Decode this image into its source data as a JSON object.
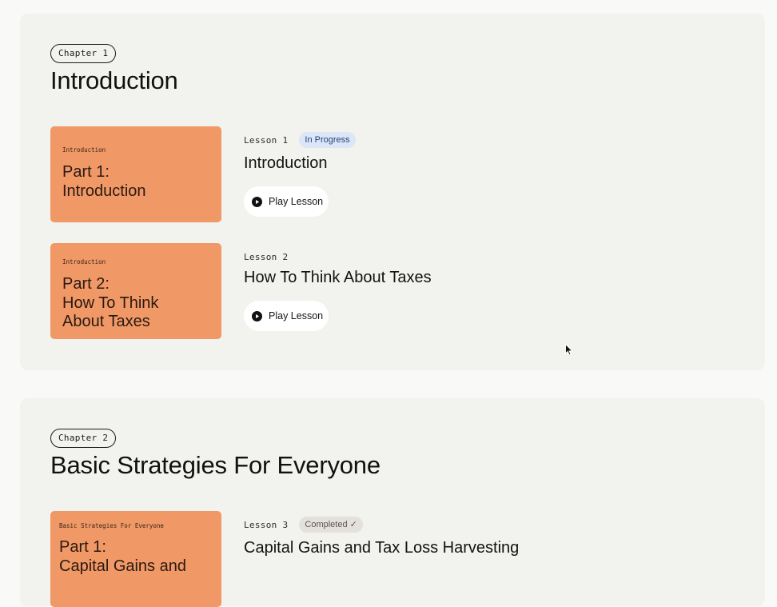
{
  "chapters": [
    {
      "pill": "Chapter 1",
      "title": "Introduction",
      "lessons": [
        {
          "number": "Lesson 1",
          "badge": "In Progress",
          "title": "Introduction",
          "thumb_tag": "Introduction",
          "thumb_title": "Part 1:\nIntroduction",
          "button": "Play Lesson"
        },
        {
          "number": "Lesson 2",
          "title": "How To Think About Taxes",
          "thumb_tag": "Introduction",
          "thumb_title": "Part 2:\nHow To Think\nAbout Taxes",
          "button": "Play Lesson"
        }
      ]
    },
    {
      "pill": "Chapter 2",
      "title": "Basic Strategies For Everyone",
      "lessons": [
        {
          "number": "Lesson 3",
          "badge": "Completed ✓",
          "title": "Capital Gains and Tax Loss Harvesting",
          "thumb_tag": "Basic Strategies For Everyone",
          "thumb_title": "Part 1:\nCapital Gains and"
        }
      ]
    }
  ],
  "colors": {
    "thumbnail": "#f09866",
    "card": "#f2f2ee",
    "in_progress_badge": "#dce6f7",
    "completed_badge": "#e4e1dc"
  },
  "icons": {
    "play": "play-circle-icon",
    "cursor": "mouse-pointer-icon"
  }
}
